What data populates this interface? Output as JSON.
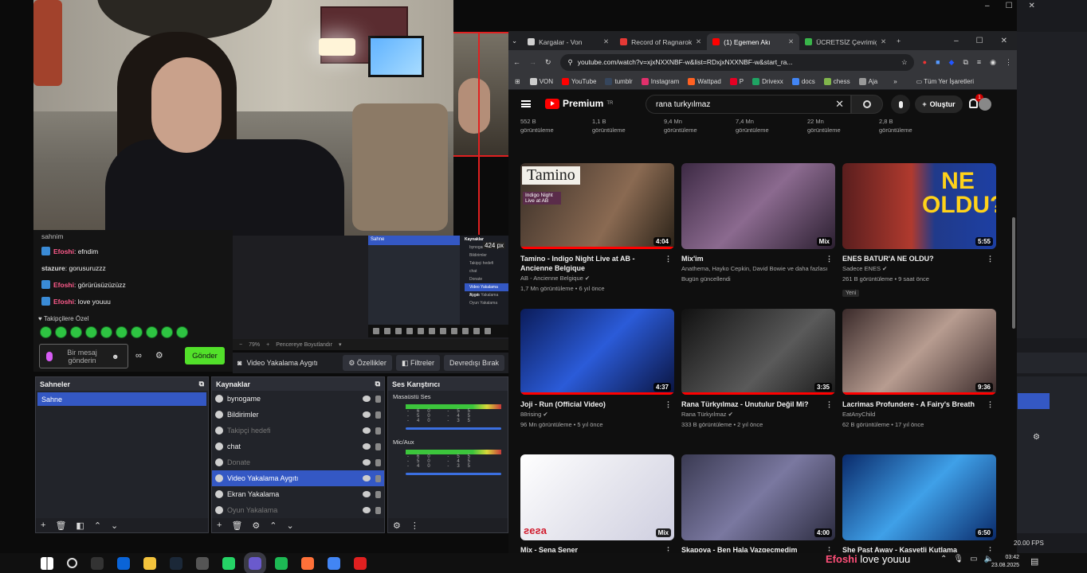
{
  "chat": {
    "top_partial": "sahnim",
    "messages": [
      {
        "user": "Efoshi",
        "text": ": efndim",
        "style": "u1",
        "badge": true
      },
      {
        "user": "stazure",
        "text": ": gorusuruzzz",
        "style": "u2",
        "badge": false
      },
      {
        "user": "Efoshi",
        "text": ": görürüsüzüzüzz",
        "style": "u1",
        "badge": true
      },
      {
        "user": "Efoshi",
        "text": ": love youuu",
        "style": "u1",
        "badge": true
      }
    ],
    "followers_only": "Takipçilere Özel",
    "input_placeholder": "Bir mesaj gönderin",
    "send_label": "Gönder"
  },
  "obs": {
    "preview_px_label": "424 px",
    "zoom_label": "79%",
    "fit_label": "Pencereye Boyutlandır",
    "source_name": "Video Yakalama Aygıtı",
    "properties_label": "Özellikler",
    "filters_label": "Filtreler",
    "deactivate_label": "Devredışı Bırak",
    "scenes_title": "Sahneler",
    "scenes": [
      "Sahne"
    ],
    "sources_title": "Kaynaklar",
    "sources": [
      {
        "name": "bynogame",
        "dim": false,
        "selected": false
      },
      {
        "name": "Bildirimler",
        "dim": false,
        "selected": false
      },
      {
        "name": "Takipçi hedefi",
        "dim": true,
        "selected": false
      },
      {
        "name": "chat",
        "dim": false,
        "selected": false
      },
      {
        "name": "Donate",
        "dim": true,
        "selected": false
      },
      {
        "name": "Video Yakalama Aygıtı",
        "dim": false,
        "selected": true
      },
      {
        "name": "Ekran Yakalama",
        "dim": false,
        "selected": false
      },
      {
        "name": "Oyun Yakalama",
        "dim": true,
        "selected": false
      }
    ],
    "mixer_title": "Ses Karıştırıcı",
    "mixer_channels": [
      "Masaüstü Ses",
      "Mic/Aux"
    ],
    "mixer_ticks": "-60 -55 -50 -45 -40 -35",
    "mini_scene": "Sahne",
    "mini_sources_title": "Kaynaklar",
    "mini_sources": [
      "bynogame",
      "Bildirimler",
      "Takipçi hedefi",
      "chat",
      "Donate",
      "Video Yakalama Aygıtı",
      "Ekran Yakalama",
      "Oyun Yakalama"
    ],
    "fps": "20.00 FPS"
  },
  "browser": {
    "tabs": [
      {
        "title": "Kargalar - Von",
        "color": "#d0d0d0",
        "active": false
      },
      {
        "title": "Record of Ragnarok",
        "color": "#e53935",
        "active": false
      },
      {
        "title": "(1) Egemen Akı",
        "color": "#ff0000",
        "active": true
      },
      {
        "title": "ÜCRETSİZ Çevrimiçi",
        "color": "#39b54a",
        "active": false
      }
    ],
    "url": "youtube.com/watch?v=xjxNXXNBF-w&list=RDxjxNXXNBF-w&start_ra...",
    "bookmarks": [
      {
        "label": "VON",
        "color": "#cccccc"
      },
      {
        "label": "YouTube",
        "color": "#ff0000"
      },
      {
        "label": "tumblr",
        "color": "#36465d"
      },
      {
        "label": "Instagram",
        "color": "#e1306c"
      },
      {
        "label": "Wattpad",
        "color": "#ff6122"
      },
      {
        "label": "P",
        "color": "#e60023"
      },
      {
        "label": "Drivexx",
        "color": "#1fa463"
      },
      {
        "label": "docs",
        "color": "#4285f4"
      },
      {
        "label": "chess",
        "color": "#81b64c"
      },
      {
        "label": "Aja",
        "color": "#999999"
      }
    ],
    "all_bookmarks": "Tüm Yer İşaretleri"
  },
  "youtube": {
    "logo": "Premium",
    "logo_sup": "TR",
    "search_query": "rana turkyılmaz",
    "create_label": "Oluştur",
    "notif_count": "1",
    "views_row": [
      {
        "a": "552 B",
        "b": "görüntüleme"
      },
      {
        "a": "1,1 B",
        "b": "görüntüleme"
      },
      {
        "a": "9,4 Mn",
        "b": "görüntüleme"
      },
      {
        "a": "7,4 Mn",
        "b": "görüntüleme"
      },
      {
        "a": "22 Mn",
        "b": "görüntüleme"
      },
      {
        "a": "2,8 B",
        "b": "görüntüleme"
      }
    ],
    "videos": [
      {
        "title": "Tamino - Indigo Night Live at AB - Ancienne Belgique",
        "channel": "AB - Ancienne Belgique ✔",
        "meta": "1,7 Mn görüntüleme • 6 yıl önce",
        "dur": "4:04",
        "bg": "linear-gradient(120deg,#3a2f28,#8a6a52 60%,#2a2218)",
        "progress": 100
      },
      {
        "title": "Mix'im",
        "channel": "Anathema, Hayko Cepkin, David Bowie ve daha fazlası",
        "meta": "Bugün güncellendi",
        "dur": "Mix",
        "bg": "linear-gradient(135deg,#3d2a44,#8b6a8f 50%,#2b1f30)",
        "progress": 0
      },
      {
        "title": "ENES BATUR'A NE OLDU?",
        "channel": "Sadece ENES ✔",
        "meta": "261 B görüntüleme • 9 saat önce",
        "dur": "5:55",
        "bg": "linear-gradient(90deg,#5a1e1e,#b03a2e 45%,#203a8a 60%,#1d3fa3)",
        "progress": 0,
        "new": "Yeni"
      },
      {
        "title": "Joji - Run (Official Video)",
        "channel": "88rising ✔",
        "meta": "96 Mn görüntüleme • 5 yıl önce",
        "dur": "4:37",
        "bg": "linear-gradient(135deg,#0b1c5a,#2b5bd8 50%,#0a1440)",
        "progress": 100
      },
      {
        "title": "Rana Türkyılmaz - Unutulur Değil Mi?",
        "channel": "Rana Türkyılmaz ✔",
        "meta": "333 B görüntüleme • 2 yıl önce",
        "dur": "3:35",
        "bg": "linear-gradient(135deg,#111,#5a5a5a 60%,#1a1a1a)",
        "progress": 100
      },
      {
        "title": "Lacrimas Profundere - A Fairy's Breath",
        "channel": "EatAnyChild",
        "meta": "62 B görüntüleme • 17 yıl önce",
        "dur": "9:36",
        "bg": "linear-gradient(135deg,#3a2a2a,#b79c90 50%,#3a2a2a)",
        "progress": 100
      },
      {
        "title": "Mix - Sena Şener",
        "channel": "",
        "meta": "",
        "dur": "Mix",
        "bg": "linear-gradient(135deg,#fff,#e6e6ee 50%,#cfcfe0)",
        "progress": 0
      },
      {
        "title": "Skapova - Ben Hala Vazgeçmedim",
        "channel": "",
        "meta": "",
        "dur": "4:00",
        "bg": "linear-gradient(135deg,#3a3a52,#7a78a0 50%,#2c2c40)",
        "progress": 0
      },
      {
        "title": "She Past Away - Kasvetli Kutlama",
        "channel": "",
        "meta": "",
        "dur": "6:50",
        "bg": "linear-gradient(135deg,#0a2a6a,#3fa0e8 50%,#0a2a6a)",
        "progress": 0
      }
    ],
    "thumb_overlays": {
      "tamino": "Tamino",
      "tamino_sub": "Indigo Night Live at AB",
      "enes": "NE OLDU?",
      "sena": "ƨeƨa"
    }
  },
  "taskbar": {
    "overlay_user": "Efoshi",
    "overlay_text": "love youuu",
    "time": "03:42",
    "date": "23.08.2025",
    "icons": [
      "windows",
      "search",
      "epic",
      "outlook",
      "files",
      "steam",
      "app",
      "whatsapp",
      "obs",
      "spotify",
      "firefox",
      "chrome",
      "app2"
    ],
    "icon_colors": [
      "#fff",
      "#ddd",
      "#333",
      "#0a64d8",
      "#f3c33c",
      "#1b2838",
      "#555",
      "#25d366",
      "#6a5acd",
      "#1db954",
      "#ff7139",
      "#4285f4",
      "#e02020"
    ]
  }
}
